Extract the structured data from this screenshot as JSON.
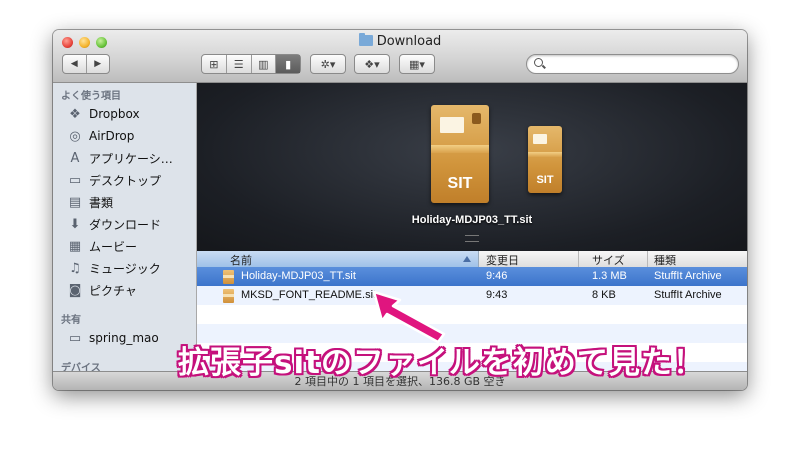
{
  "window": {
    "title": "Download"
  },
  "toolbar": {
    "back_label": "◀",
    "forward_label": "▶",
    "view_icon": "⊞",
    "list_icon": "☰",
    "column_icon": "▥",
    "coverflow_icon": "▮",
    "action_icon": "✲▾",
    "dropbox_icon": "❖▾",
    "arrange_icon": "▦▾",
    "search_placeholder": ""
  },
  "sidebar": {
    "favorites_header": "よく使う項目",
    "items": [
      {
        "label": "Dropbox",
        "icon": "dropbox-icon",
        "glyph": "❖"
      },
      {
        "label": "AirDrop",
        "icon": "airdrop-icon",
        "glyph": "◎"
      },
      {
        "label": "アプリケーシ…",
        "icon": "applications-icon",
        "glyph": "A"
      },
      {
        "label": "デスクトップ",
        "icon": "desktop-icon",
        "glyph": "▭"
      },
      {
        "label": "書類",
        "icon": "documents-icon",
        "glyph": "▤"
      },
      {
        "label": "ダウンロード",
        "icon": "downloads-icon",
        "glyph": "⬇"
      },
      {
        "label": "ムービー",
        "icon": "movies-icon",
        "glyph": "▦"
      },
      {
        "label": "ミュージック",
        "icon": "music-icon",
        "glyph": "♫"
      },
      {
        "label": "ピクチャ",
        "icon": "pictures-icon",
        "glyph": "◙"
      }
    ],
    "shared_header": "共有",
    "shared_items": [
      {
        "label": "spring_mao",
        "icon": "computer-icon",
        "glyph": "▭"
      }
    ],
    "devices_header": "デバイス"
  },
  "preview": {
    "filename": "Holiday-MDJP03_TT.sit",
    "badge_text": "SIT"
  },
  "list": {
    "columns": {
      "name": "名前",
      "modified": "変更日",
      "size": "サイズ",
      "kind": "種類"
    },
    "rows": [
      {
        "name": "Holiday-MDJP03_TT.sit",
        "modified": "9:46",
        "size": "1.3 MB",
        "kind": "StuffIt Archive",
        "selected": true
      },
      {
        "name": "MKSD_FONT_README.sit",
        "modified": "9:43",
        "size": "8 KB",
        "kind": "StuffIt Archive",
        "selected": false
      }
    ]
  },
  "status": {
    "text": "2 項目中の 1 項目を選択、136.8 GB 空き"
  },
  "caption": {
    "text": "拡張子sitのファイルを初めて見た！"
  },
  "colors": {
    "accent": "#3c74cb",
    "caption_outline": "#c5117c",
    "arrow": "#e0157f"
  }
}
